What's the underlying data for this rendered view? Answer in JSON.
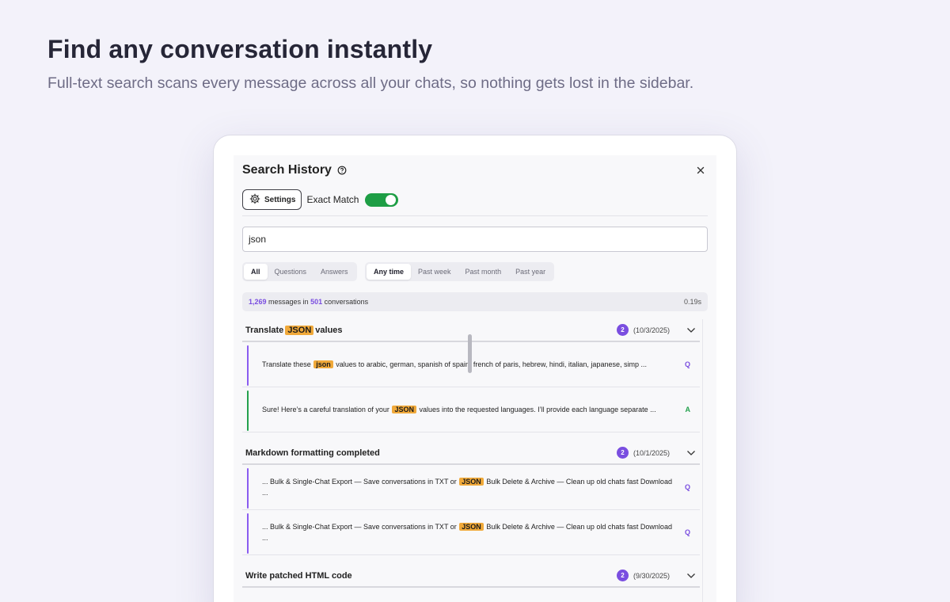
{
  "hero": {
    "title": "Find any conversation instantly",
    "subtitle": "Full-text search scans every message across all your chats, so nothing gets lost in the sidebar."
  },
  "panel": {
    "title": "Search History",
    "help_icon": "question-circle-icon",
    "close_icon": "close-icon",
    "settings_label": "Settings",
    "settings_icon": "gear-icon",
    "exact_match_label": "Exact Match",
    "exact_match_on": true,
    "search_value": "json",
    "type_filters": [
      {
        "label": "All",
        "active": true
      },
      {
        "label": "Questions",
        "active": false
      },
      {
        "label": "Answers",
        "active": false
      }
    ],
    "time_filters": [
      {
        "label": "Any time",
        "active": true
      },
      {
        "label": "Past week",
        "active": false
      },
      {
        "label": "Past month",
        "active": false
      },
      {
        "label": "Past year",
        "active": false
      }
    ],
    "stats": {
      "messages": "1,269",
      "messages_text": "messages in",
      "conversations": "501",
      "conversations_text": "conversations",
      "time": "0.19s"
    },
    "colors": {
      "accent": "#7a4ee0",
      "highlight": "#f0a93a",
      "answer": "#23a14d",
      "toggle": "#1e9e45"
    }
  },
  "groups": [
    {
      "title_before": "Translate",
      "title_hl": "JSON",
      "title_after": "values",
      "count": "2",
      "date": "(10/3/2025)",
      "messages": [
        {
          "kind": "Q",
          "before": "Translate these",
          "hl": "json",
          "after": "values to arabic, german, spanish of spain, french of paris, hebrew, hindi, italian, japanese, simp ..."
        },
        {
          "kind": "A",
          "before": "Sure! Here’s a careful translation of your",
          "hl": "JSON",
          "after": "values into the requested languages. I’ll provide each language separate ..."
        }
      ]
    },
    {
      "title_before": "Markdown formatting completed",
      "count": "2",
      "date": "(10/1/2025)",
      "messages": [
        {
          "kind": "Q",
          "before": "... Bulk & Single-Chat Export — Save conversations in TXT or",
          "hl": "JSON",
          "after": "Bulk Delete & Archive — Clean up old chats fast Download ..."
        },
        {
          "kind": "Q",
          "before": "... Bulk & Single-Chat Export — Save conversations in TXT or",
          "hl": "JSON",
          "after": "Bulk Delete & Archive — Clean up old chats fast Download ..."
        }
      ]
    },
    {
      "title_before": "Write patched HTML code",
      "count": "2",
      "date": "(9/30/2025)"
    }
  ]
}
